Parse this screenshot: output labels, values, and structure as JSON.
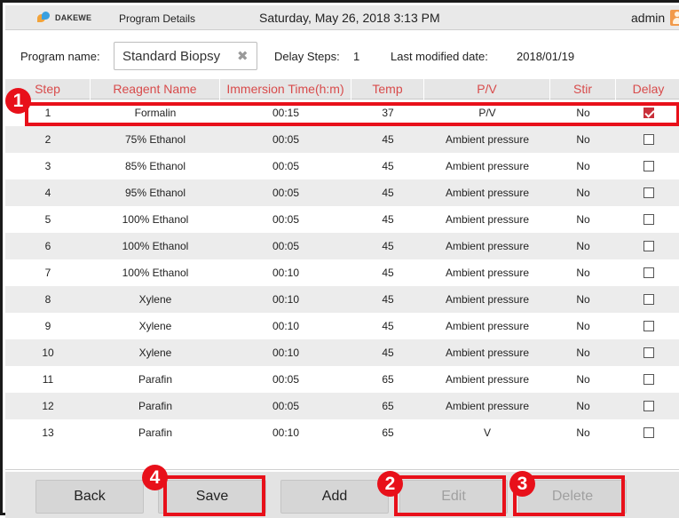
{
  "topbar": {
    "logo_text": "DAKEWE",
    "title": "Program Details",
    "datetime": "Saturday, May 26, 2018 3:13 PM",
    "user": "admin"
  },
  "info": {
    "program_name_label": "Program name:",
    "program_name_value": "Standard Biopsy",
    "delay_steps_label": "Delay Steps:",
    "delay_steps_value": "1",
    "last_modified_label": "Last modified date:",
    "last_modified_value": "2018/01/19"
  },
  "table": {
    "headers": [
      "Step",
      "Reagent Name",
      "Immersion Time(h:m)",
      "Temp",
      "P/V",
      "Stir",
      "Delay"
    ],
    "rows": [
      {
        "step": "1",
        "reagent": "Formalin",
        "time": "00:15",
        "temp": "37",
        "pv": "P/V",
        "stir": "No",
        "delay": true
      },
      {
        "step": "2",
        "reagent": "75% Ethanol",
        "time": "00:05",
        "temp": "45",
        "pv": "Ambient pressure",
        "stir": "No",
        "delay": false
      },
      {
        "step": "3",
        "reagent": "85% Ethanol",
        "time": "00:05",
        "temp": "45",
        "pv": "Ambient pressure",
        "stir": "No",
        "delay": false
      },
      {
        "step": "4",
        "reagent": "95% Ethanol",
        "time": "00:05",
        "temp": "45",
        "pv": "Ambient pressure",
        "stir": "No",
        "delay": false
      },
      {
        "step": "5",
        "reagent": "100% Ethanol",
        "time": "00:05",
        "temp": "45",
        "pv": "Ambient pressure",
        "stir": "No",
        "delay": false
      },
      {
        "step": "6",
        "reagent": "100% Ethanol",
        "time": "00:05",
        "temp": "45",
        "pv": "Ambient pressure",
        "stir": "No",
        "delay": false
      },
      {
        "step": "7",
        "reagent": "100% Ethanol",
        "time": "00:10",
        "temp": "45",
        "pv": "Ambient pressure",
        "stir": "No",
        "delay": false
      },
      {
        "step": "8",
        "reagent": "Xylene",
        "time": "00:10",
        "temp": "45",
        "pv": "Ambient pressure",
        "stir": "No",
        "delay": false
      },
      {
        "step": "9",
        "reagent": "Xylene",
        "time": "00:10",
        "temp": "45",
        "pv": "Ambient pressure",
        "stir": "No",
        "delay": false
      },
      {
        "step": "10",
        "reagent": "Xylene",
        "time": "00:10",
        "temp": "45",
        "pv": "Ambient pressure",
        "stir": "No",
        "delay": false
      },
      {
        "step": "11",
        "reagent": "Parafin",
        "time": "00:05",
        "temp": "65",
        "pv": "Ambient pressure",
        "stir": "No",
        "delay": false
      },
      {
        "step": "12",
        "reagent": "Parafin",
        "time": "00:05",
        "temp": "65",
        "pv": "Ambient pressure",
        "stir": "No",
        "delay": false
      },
      {
        "step": "13",
        "reagent": "Parafin",
        "time": "00:10",
        "temp": "65",
        "pv": "V",
        "stir": "No",
        "delay": false
      }
    ]
  },
  "buttons": {
    "back": "Back",
    "save": "Save",
    "add": "Add",
    "edit": "Edit",
    "delete": "Delete"
  },
  "annotations": {
    "badge_1": "1",
    "badge_2": "2",
    "badge_3": "3",
    "badge_4": "4"
  },
  "colors": {
    "header_text": "#d84b4b",
    "highlight": "#e8101a",
    "checked": "#c9303a"
  },
  "icons": {
    "logo": "dakewe-logo-icon",
    "clear": "clear-x-icon",
    "avatar": "user-avatar-icon",
    "checkbox": "checkbox-icon"
  }
}
